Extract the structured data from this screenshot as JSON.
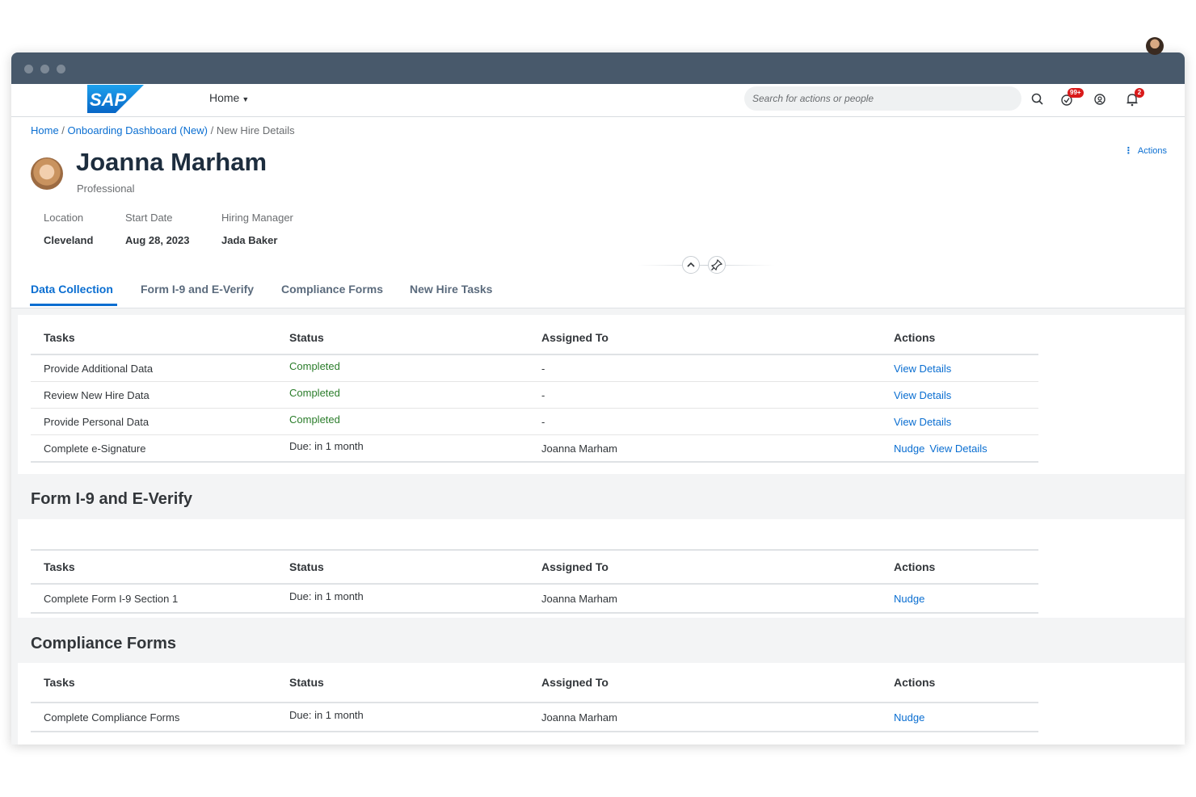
{
  "shell": {
    "home_label": "Home",
    "search_placeholder": "Search for actions or people",
    "todo_badge": "99+",
    "notif_badge": "2",
    "logo_text": "SAP"
  },
  "breadcrumb": {
    "home": "Home",
    "separator": " / ",
    "dashboard": "Onboarding Dashboard (New)",
    "current": "New Hire Details"
  },
  "header": {
    "name": "Joanna Marham",
    "role": "Professional",
    "actions_label": "Actions",
    "attributes": [
      {
        "label": "Location",
        "value": "Cleveland"
      },
      {
        "label": "Start Date",
        "value": "Aug 28, 2023"
      },
      {
        "label": "Hiring Manager",
        "value": "Jada Baker"
      }
    ]
  },
  "tabs": [
    {
      "label": "Data Collection",
      "active": true
    },
    {
      "label": "Form I-9 and E-Verify",
      "active": false
    },
    {
      "label": "Compliance Forms",
      "active": false
    },
    {
      "label": "New Hire Tasks",
      "active": false
    }
  ],
  "columns": {
    "tasks": "Tasks",
    "status": "Status",
    "assigned": "Assigned To",
    "actions": "Actions"
  },
  "data_collection": {
    "rows": [
      {
        "task": "Provide Additional Data",
        "status": "Completed",
        "assigned": "-",
        "action1": "View Details",
        "action2": ""
      },
      {
        "task": "Review New Hire Data",
        "status": "Completed",
        "assigned": "-",
        "action1": "View Details",
        "action2": ""
      },
      {
        "task": "Provide Personal Data",
        "status": "Completed",
        "assigned": "-",
        "action1": "View Details",
        "action2": ""
      },
      {
        "task": "Complete e-Signature",
        "status": "Due: in 1 month",
        "assigned": "Joanna Marham",
        "action1": "Nudge",
        "action2": "View Details"
      }
    ]
  },
  "i9": {
    "title": "Form I-9 and E-Verify",
    "rows": [
      {
        "task": "Complete Form I-9 Section 1",
        "status": "Due: in 1 month",
        "assigned": "Joanna Marham",
        "action1": "Nudge"
      }
    ]
  },
  "compliance": {
    "title": "Compliance Forms",
    "rows": [
      {
        "task": "Complete Compliance Forms",
        "status": "Due: in 1 month",
        "assigned": "Joanna Marham",
        "action1": "Nudge"
      }
    ]
  },
  "colors": {
    "accent": "#0a6ed1",
    "success": "#2b7d2b",
    "chrome": "#48596b",
    "badge": "#d91a1a"
  }
}
